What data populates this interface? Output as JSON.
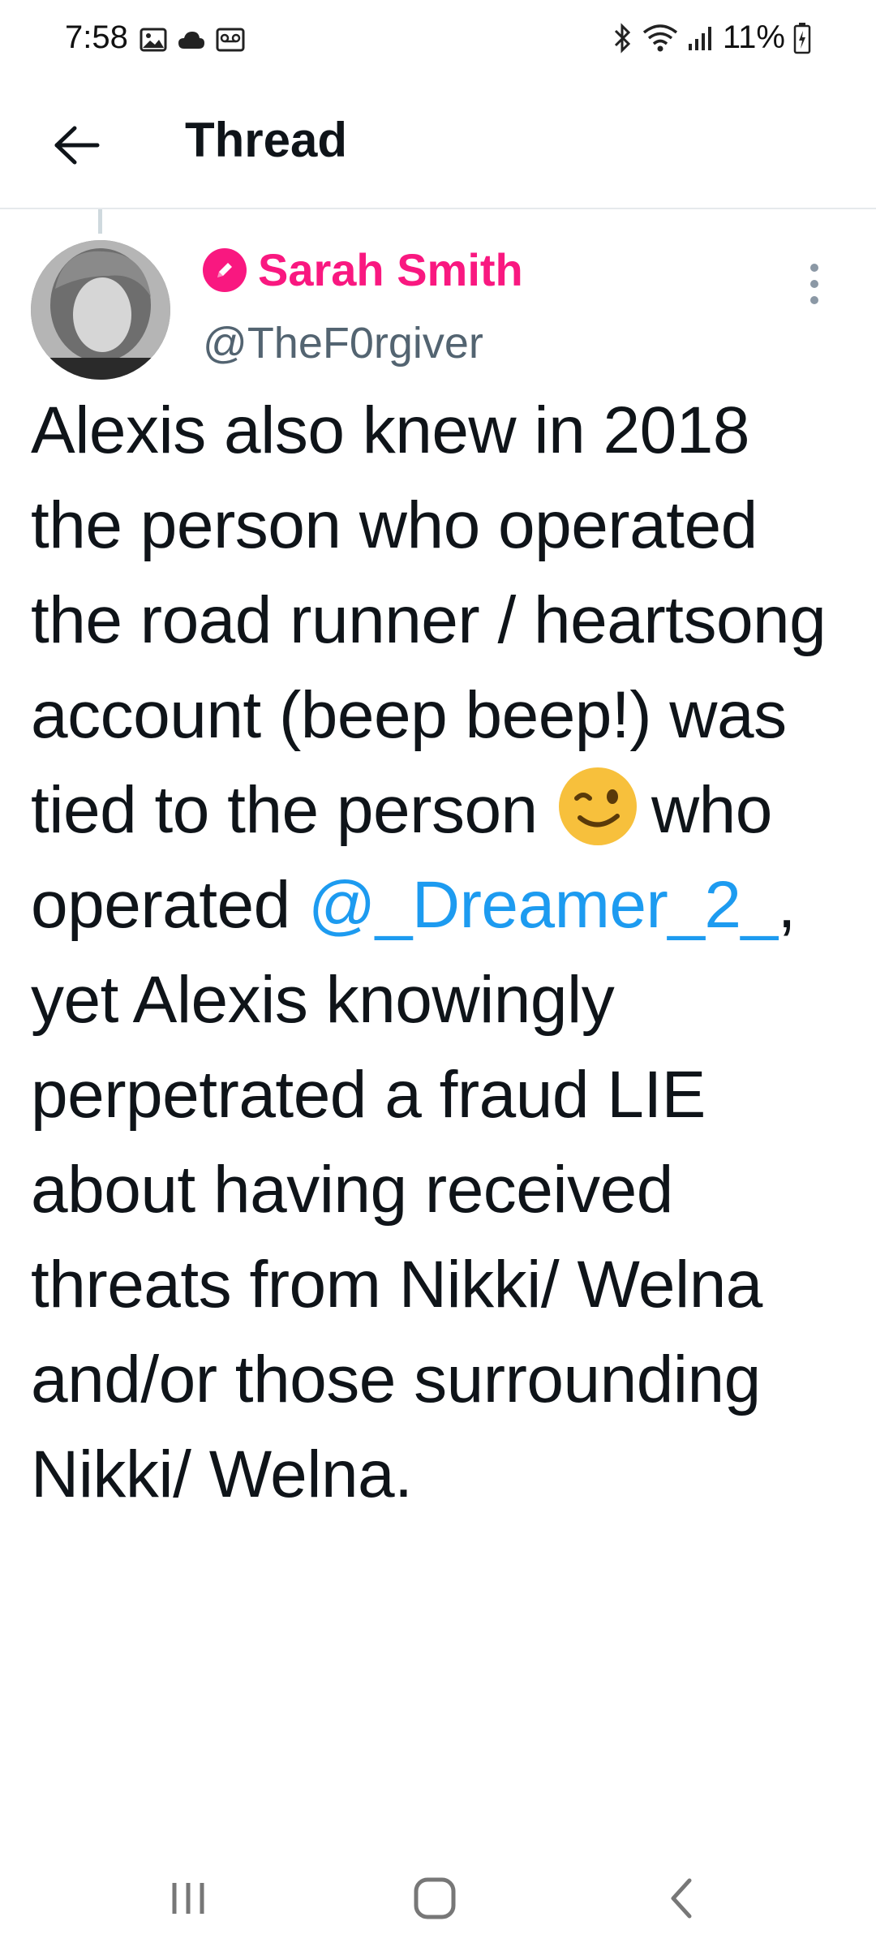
{
  "status_bar": {
    "time": "7:58",
    "battery": "11%",
    "left_icons": [
      "gallery-icon",
      "cloud-icon",
      "voicemail-icon"
    ],
    "right_icons": [
      "bluetooth-icon",
      "wifi-icon",
      "signal-icon",
      "battery-charging-icon"
    ]
  },
  "header": {
    "title": "Thread",
    "back_icon": "arrow-left-icon"
  },
  "tweet": {
    "author_name": "Sarah Smith",
    "author_handle": "@TheF0rgiver",
    "badge_icon": "pencil-badge-icon",
    "text_before_emoji": "Alexis also knew in 2018 the person who operated the road runner / heartsong account (beep beep!) was tied to the person",
    "emoji": "winking-face-icon",
    "text_after_emoji": "who operated",
    "mention": "@_Dreamer_2_",
    "text_after_mention": ", yet Alexis knowingly perpetrated a fraud LIE about having received threats from Nikki/ Welna and/or those surrounding Nikki/ Welna."
  },
  "nav_bar": {
    "buttons": [
      "recent-apps-icon",
      "home-icon",
      "back-icon"
    ]
  },
  "colors": {
    "name_accent": "#f91880",
    "link": "#1d9bf0",
    "handle": "#536471",
    "text": "#0f1419"
  }
}
